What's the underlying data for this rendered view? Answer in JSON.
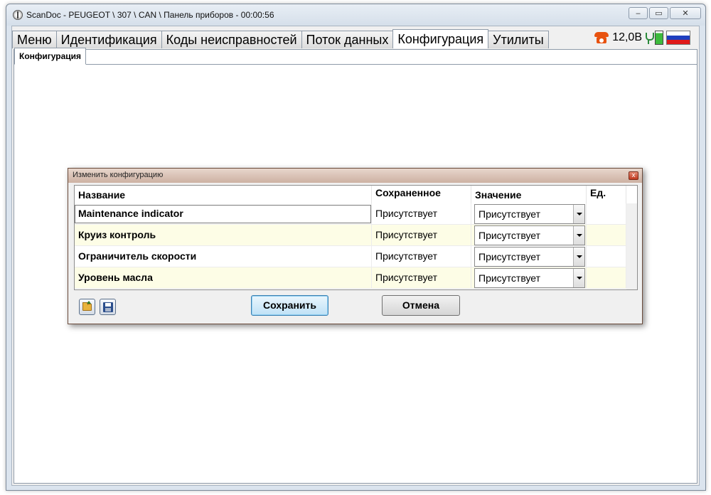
{
  "window": {
    "title": "ScanDoc - PEUGEOT \\ 307 \\ CAN \\ Панель приборов - 00:00:56",
    "minimize": "‒",
    "maximize": "▭",
    "close": "✕"
  },
  "tabs": [
    {
      "label": "Меню"
    },
    {
      "label": "Идентификация"
    },
    {
      "label": "Коды неисправностей"
    },
    {
      "label": "Поток данных"
    },
    {
      "label": "Конфигурация"
    },
    {
      "label": "Утилиты"
    }
  ],
  "active_tab": "Конфигурация",
  "status": {
    "voltage": "12,0В",
    "icons": [
      "phone-icon",
      "plug-icon",
      "battery-icon",
      "flag-ru-icon"
    ],
    "flag_colors": [
      "#ffffff",
      "#1f3fbf",
      "#e01a1a"
    ]
  },
  "subtab": {
    "label": "Конфигурация"
  },
  "dialog": {
    "title": "Изменить конфигурацию",
    "close": "x",
    "columns": [
      "Название",
      "Сохраненное",
      "Значение",
      "Ед."
    ],
    "rows": [
      {
        "name": "Maintenance indicator",
        "saved": "Присутствует",
        "value": "Присутствует",
        "unit": ""
      },
      {
        "name": "Круиз контроль",
        "saved": "Присутствует",
        "value": "Присутствует",
        "unit": ""
      },
      {
        "name": "Ограничитель скорости",
        "saved": "Присутствует",
        "value": "Присутствует",
        "unit": ""
      },
      {
        "name": "Уровень масла",
        "saved": "Присутствует",
        "value": "Присутствует",
        "unit": ""
      }
    ],
    "buttons": {
      "save": "Сохранить",
      "cancel": "Отмена"
    },
    "icon_buttons": [
      "open-folder-icon",
      "save-disk-icon"
    ]
  }
}
